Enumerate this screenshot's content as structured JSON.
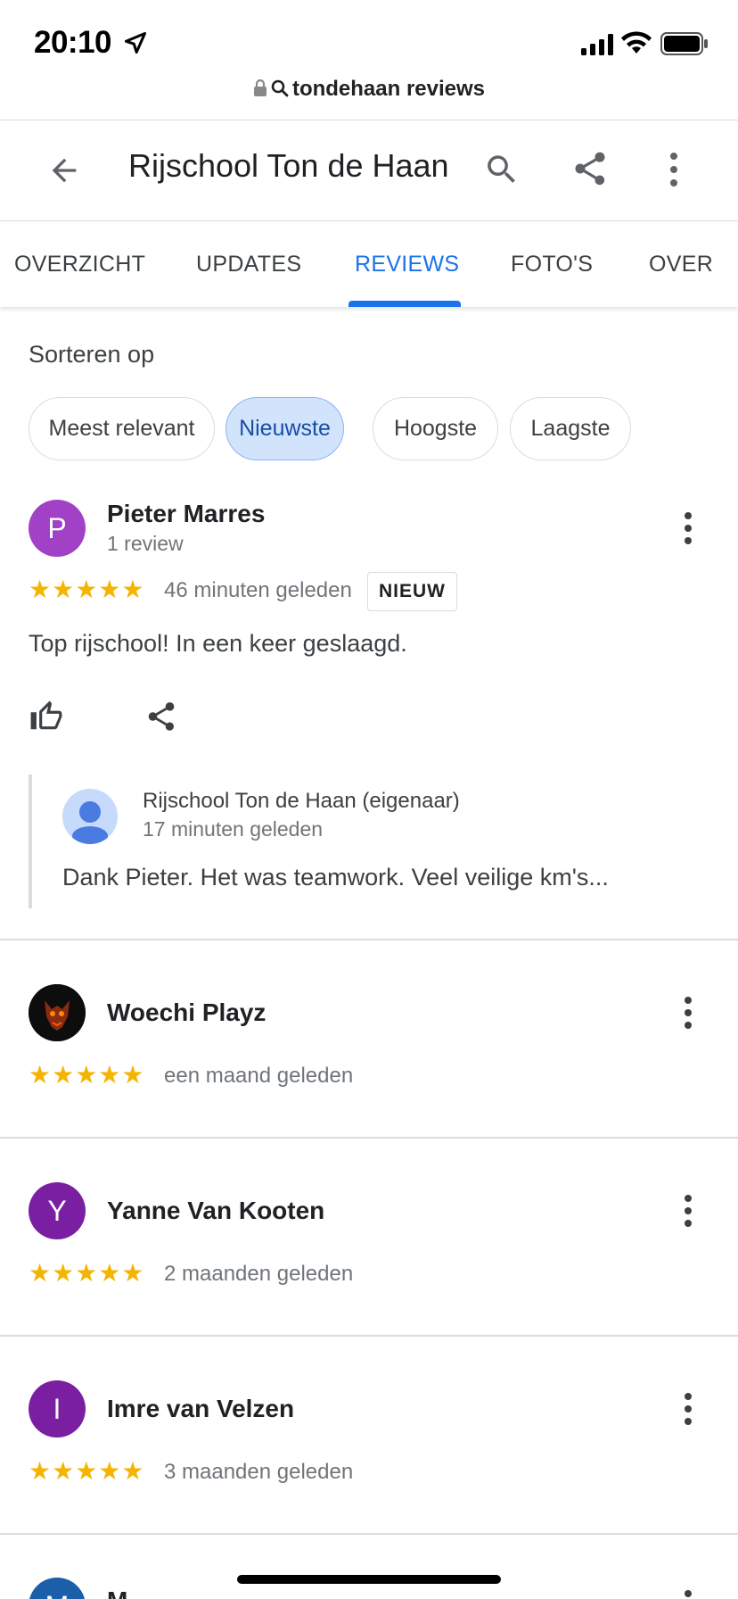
{
  "status": {
    "time": "20:10"
  },
  "browser": {
    "url": "tondehaan reviews"
  },
  "header": {
    "title": "Rijschool Ton de Haan"
  },
  "tabs": [
    {
      "label": "OVERZICHT",
      "active": false
    },
    {
      "label": "UPDATES",
      "active": false
    },
    {
      "label": "REVIEWS",
      "active": true
    },
    {
      "label": "FOTO'S",
      "active": false
    },
    {
      "label": "OVER",
      "active": false
    }
  ],
  "sort": {
    "label": "Sorteren op",
    "options": [
      "Meest relevant",
      "Nieuwste",
      "Hoogste",
      "Laagste"
    ],
    "selected": "Nieuwste"
  },
  "reviews": [
    {
      "initial": "P",
      "avatar_color": "#a142c6",
      "name": "Pieter Marres",
      "count": "1 review",
      "stars": "★★★★★",
      "rating": 5,
      "time": "46 minuten geleden",
      "badge": "NIEUW",
      "text": "Top rijschool! In een keer geslaagd.",
      "reply": {
        "name": "Rijschool Ton de Haan (eigenaar)",
        "time": "17 minuten geleden",
        "text": "Dank Pieter. Het was teamwork. Veel veilige km's..."
      }
    },
    {
      "initial": "",
      "avatar_color": "#111111",
      "name": "Woechi Playz",
      "stars": "★★★★★",
      "rating": 5,
      "time": "een maand geleden"
    },
    {
      "initial": "Y",
      "avatar_color": "#7b1fa2",
      "name": "Yanne Van Kooten",
      "stars": "★★★★★",
      "rating": 5,
      "time": "2 maanden geleden"
    },
    {
      "initial": "I",
      "avatar_color": "#7b1fa2",
      "name": "Imre van Velzen",
      "stars": "★★★★★",
      "rating": 5,
      "time": "3 maanden geleden"
    },
    {
      "initial": "M",
      "avatar_color": "#1a5fa8",
      "name": "M...",
      "stars": "",
      "rating": null,
      "time": ""
    }
  ],
  "colors": {
    "accent": "#1a73e8",
    "star": "#f4b400",
    "chip_selected": "#d2e3fc"
  }
}
